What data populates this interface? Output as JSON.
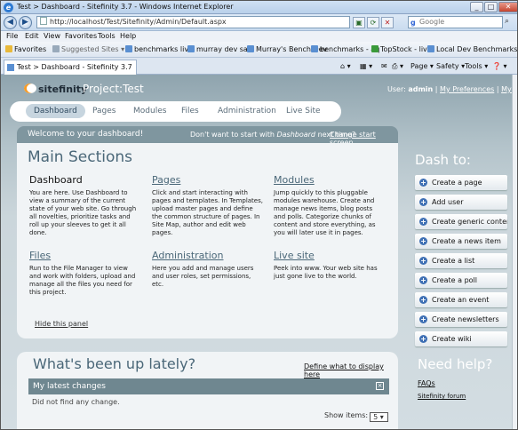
{
  "window": {
    "title": "Test > Dashboard - Sitefinity 3.7 - Windows Internet Explorer",
    "min": "_",
    "max": "□",
    "close": "✕"
  },
  "address": {
    "url": "http://localhost/Test/Sitefinity/Admin/Default.aspx",
    "search_placeholder": "Google"
  },
  "menu": [
    "File",
    "Edit",
    "View",
    "Favorites",
    "Tools",
    "Help"
  ],
  "favorites": {
    "label": "Favorites",
    "items": [
      "Suggested Sites ▾",
      "benchmarks live",
      "murray dev sale",
      "Murray's Bench Dev",
      "benchmarks - aq",
      "TopStock - live",
      "Local Dev Benchmarks"
    ]
  },
  "tab": {
    "label": "Test > Dashboard - Sitefinity 3.7"
  },
  "commands": {
    "page": "Page ▾",
    "safety": "Safety ▾",
    "tools": "Tools ▾",
    "help": "❓ ▾"
  },
  "app": {
    "logo_text": "sitefinity",
    "project": "Project:Test",
    "user_label": "User:",
    "user_name": "admin",
    "sep": "|",
    "prefs": "My Preferences",
    "profile": "My profile"
  },
  "nav": [
    "Dashboard",
    "Pages",
    "Modules",
    "Files",
    "Administration",
    "Live Site"
  ],
  "welcome": {
    "text": "Welcome to your dashboard!",
    "question_pre": "Don't want to start with",
    "question_em": "Dashboard",
    "question_post": "next time?",
    "change": "Change start screen"
  },
  "main_sections": {
    "title": "Main Sections",
    "sections": [
      {
        "title": "Dashboard",
        "desc": "You are here. Use Dashboard to view a summary of the current state of your web site. Go through all novelties, prioritize tasks and roll up your sleeves to get it all done."
      },
      {
        "title": "Pages",
        "desc": "Click and start interacting with pages and templates. In Templates, upload master pages and define the common structure of pages. In Site Map, author and edit web pages."
      },
      {
        "title": "Modules",
        "desc": "Jump quickly to this pluggable modules warehouse. Create and manage news items, blog posts and polls. Categorize chunks of content and store everything, as you will later use it in pages."
      },
      {
        "title": "Files",
        "desc": "Run to the File Manager to view and work with folders, upload and manage all the files you need for this project."
      },
      {
        "title": "Administration",
        "desc": "Here you add and manage users and user roles, set permissions, etc."
      },
      {
        "title": "Live site",
        "desc": "Peek into www. Your web site has just gone live to the world."
      }
    ],
    "hide": "Hide this panel"
  },
  "dash_to": {
    "title": "Dash to:",
    "buttons": [
      "Create a page",
      "Add user",
      "Create generic content",
      "Create a news item",
      "Create a list",
      "Create a poll",
      "Create an event",
      "Create newsletters",
      "Create wiki"
    ]
  },
  "recent": {
    "title": "What's been up lately?",
    "define": "Define what to display here",
    "panel_title": "My latest changes",
    "empty": "Did not find any change.",
    "show_items_label": "Show items:",
    "show_items_value": "5"
  },
  "help": {
    "title": "Need help?",
    "faqs": "FAQs",
    "forum": "Sitefinity forum"
  }
}
